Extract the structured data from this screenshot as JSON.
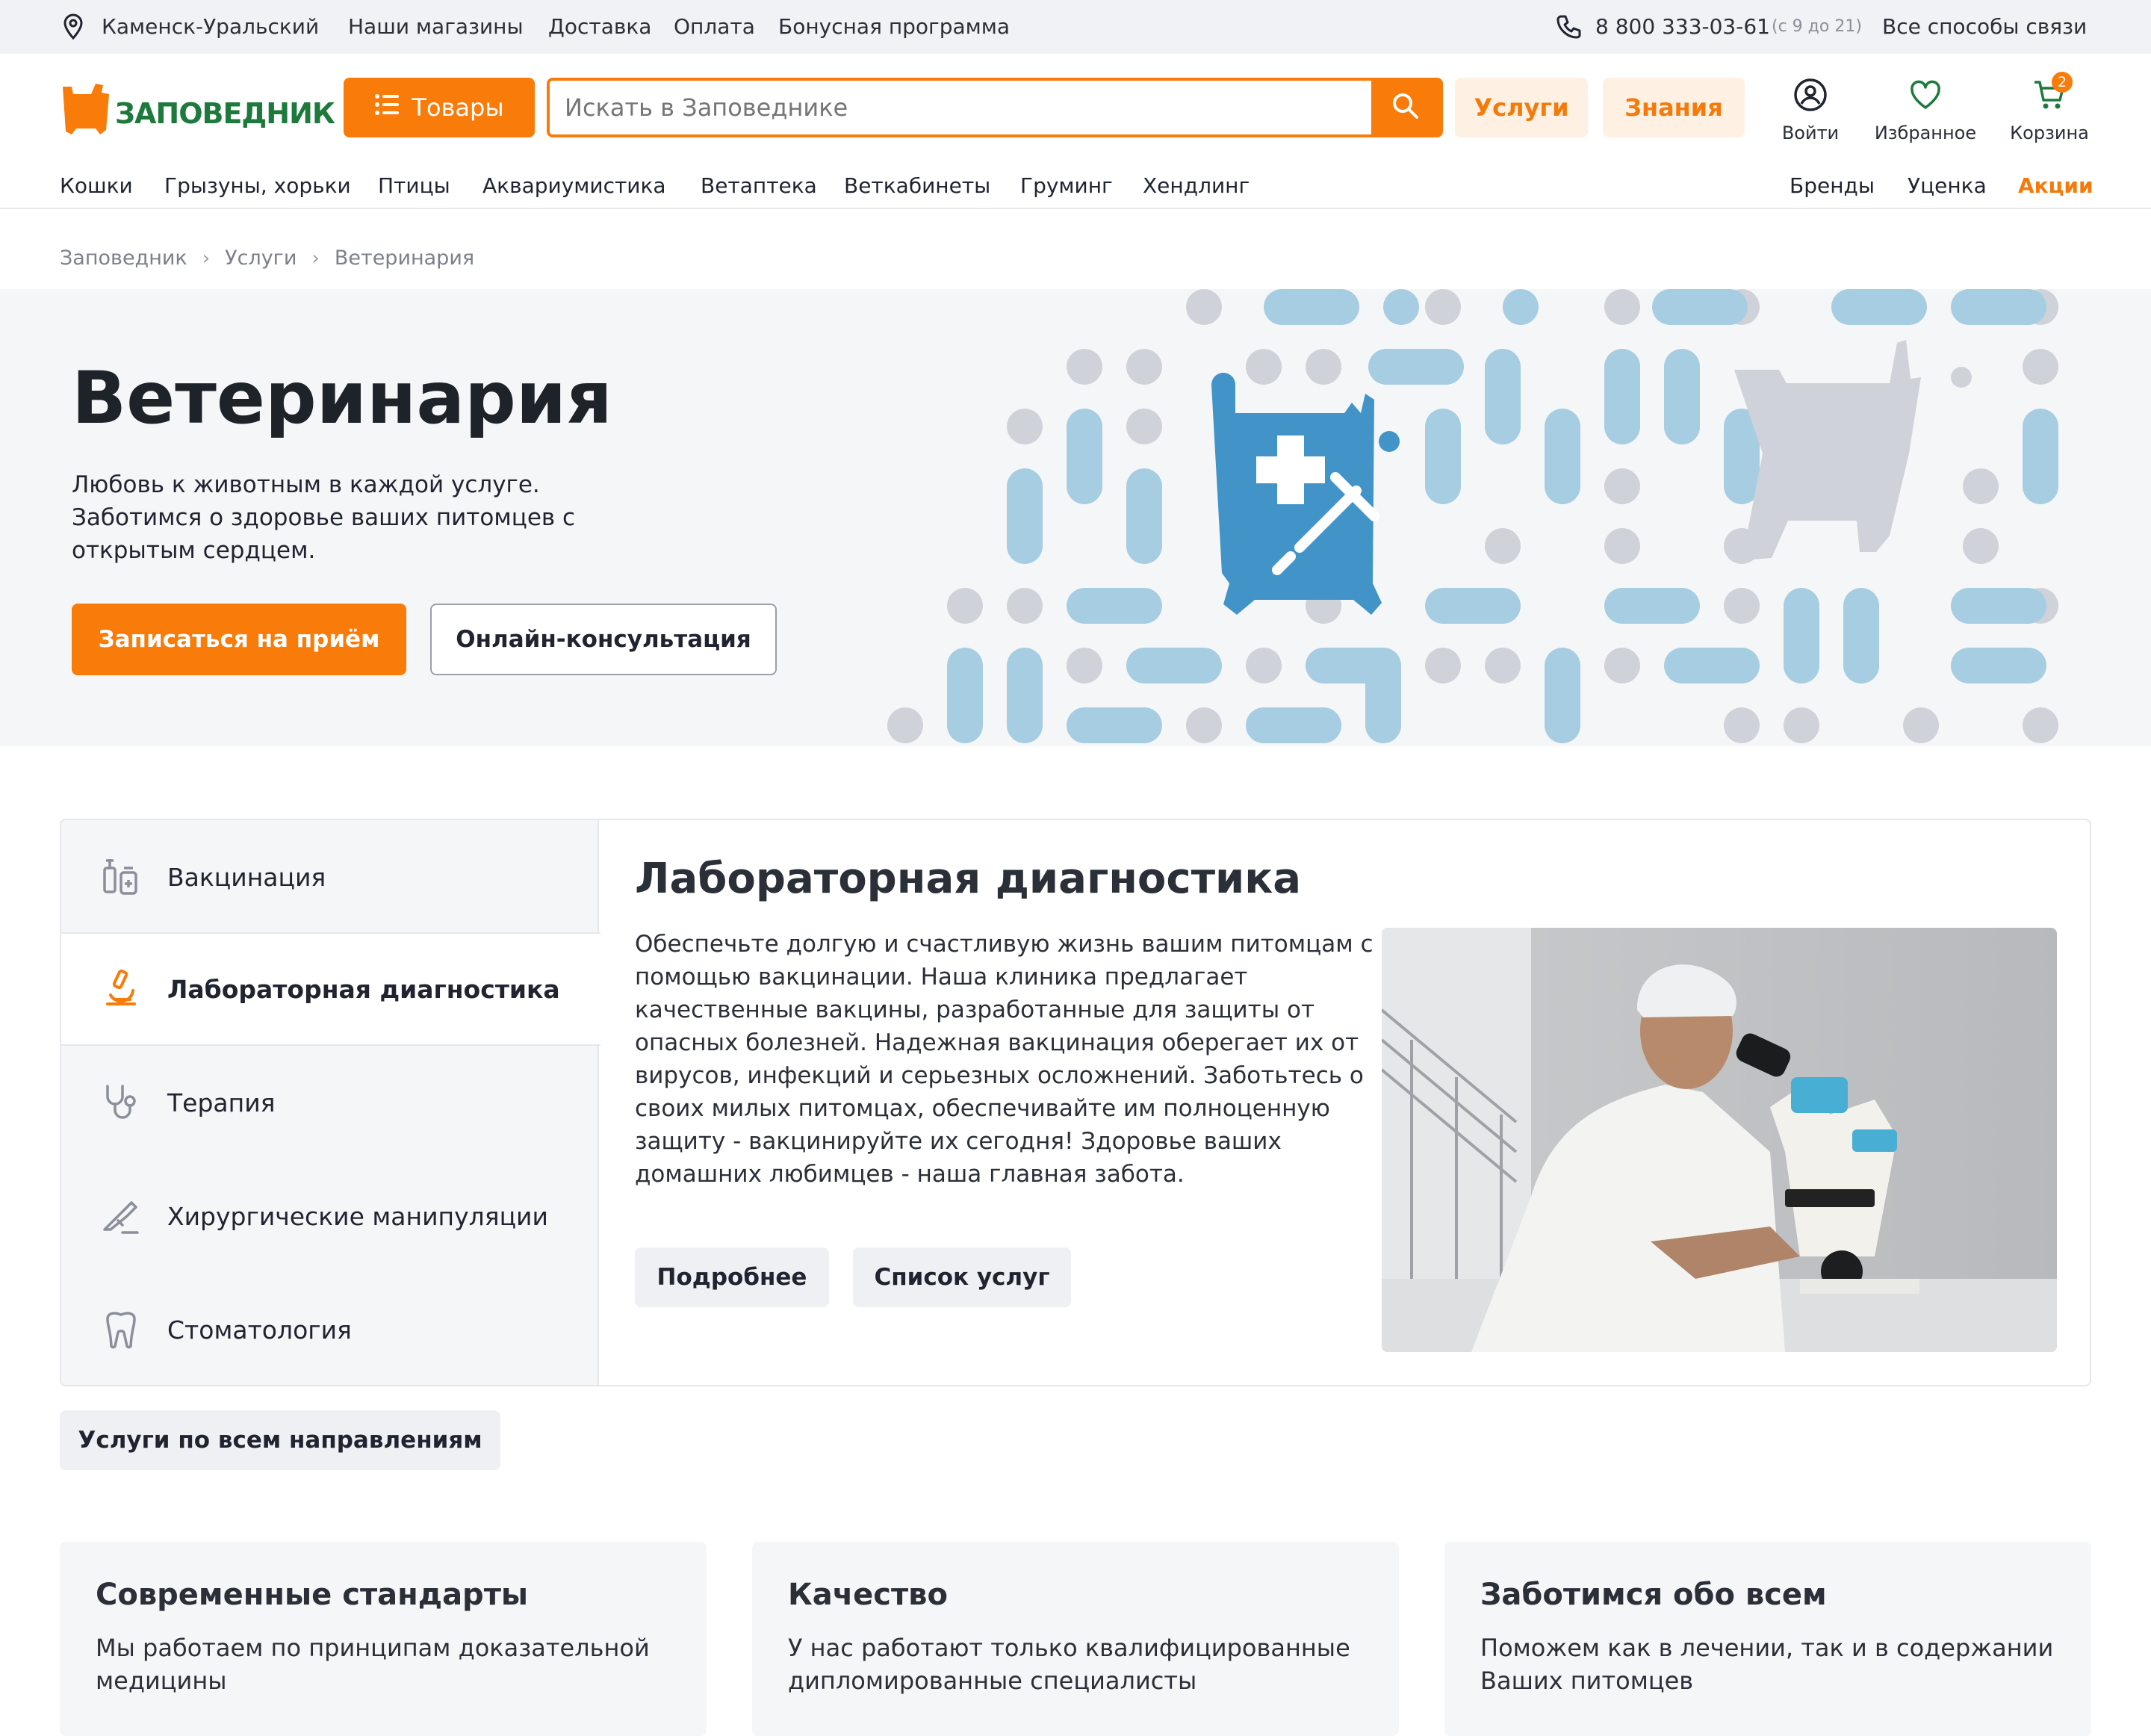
{
  "topbar": {
    "city": "Каменск-Уральский",
    "links": [
      "Наши магазины",
      "Доставка",
      "Оплата",
      "Бонусная программа"
    ],
    "phone": "8 800 333-03-61",
    "hours": "(с 9 до 21)",
    "contacts": "Все способы связи"
  },
  "header": {
    "logo": "ЗАПОВЕДНИК",
    "goods_button": "Товары",
    "search_placeholder": "Искать в Заповеднике",
    "services": "Услуги",
    "knowledge": "Знания",
    "login": "Войти",
    "favorites": "Избранное",
    "cart": "Корзина",
    "cart_count": "2"
  },
  "categories": [
    "Кошки",
    "Грызуны, хорьки",
    "Птицы",
    "Аквариумистика",
    "Ветаптека",
    "Веткабинеты",
    "Груминг",
    "Хендлинг"
  ],
  "categories_right": [
    "Бренды",
    "Уценка",
    "Акции"
  ],
  "breadcrumbs": [
    "Заповедник",
    "Услуги",
    "Ветеринария"
  ],
  "hero": {
    "title": "Ветеринария",
    "subtitle": "Любовь к животным в каждой услуге. Заботимся о здоровье ваших питомцев с открытым сердцем.",
    "primary_button": "Записаться на приём",
    "secondary_button": "Онлайн-консультация"
  },
  "services": {
    "items": [
      "Вакцинация",
      "Лабораторная диагностика",
      "Терапия",
      "Хирургические манипуляции",
      "Стоматология"
    ],
    "active_index": 1,
    "active_title": "Лабораторная диагностика",
    "description": "Обеспечьте долгую и счастливую жизнь вашим питомцам с помощью вакцинации. Наша клиника предлагает качественные вакцины, разработанные для защиты от опасных болезней. Надежная вакцинация оберегает их от вирусов, инфекций и серьезных осложнений. Заботьтесь о своих милых питомцах, обеспечивайте им полноценную защиту - вакцинируйте их сегодня! Здоровье ваших домашних любимцев - наша главная забота.",
    "more_button": "Подробнее",
    "list_button": "Список услуг",
    "all_services_button": "Услуги по всем направлениям"
  },
  "features": [
    {
      "title": "Современные стандарты",
      "text": "Мы работаем по принципам доказательной медицины"
    },
    {
      "title": "Качество",
      "text": "У нас работают только квалифицированные дипломированные специалисты"
    },
    {
      "title": "Заботимся обо всем",
      "text": "Поможем как в лечении, так и в содержании Ваших питомцев"
    }
  ],
  "colors": {
    "accent": "#f97b09",
    "brand_green": "#1d7a3c",
    "pattern_blue": "#a7cde3",
    "pattern_grey": "#cfd2d8",
    "icon_blue": "#4294c8"
  },
  "icons": [
    "location-pin-icon",
    "phone-icon",
    "menu-list-icon",
    "search-icon",
    "user-icon",
    "heart-icon",
    "cart-icon",
    "chevron-right-icon",
    "vaccine-icon",
    "microscope-icon",
    "stethoscope-icon",
    "scalpel-icon",
    "tooth-icon"
  ]
}
